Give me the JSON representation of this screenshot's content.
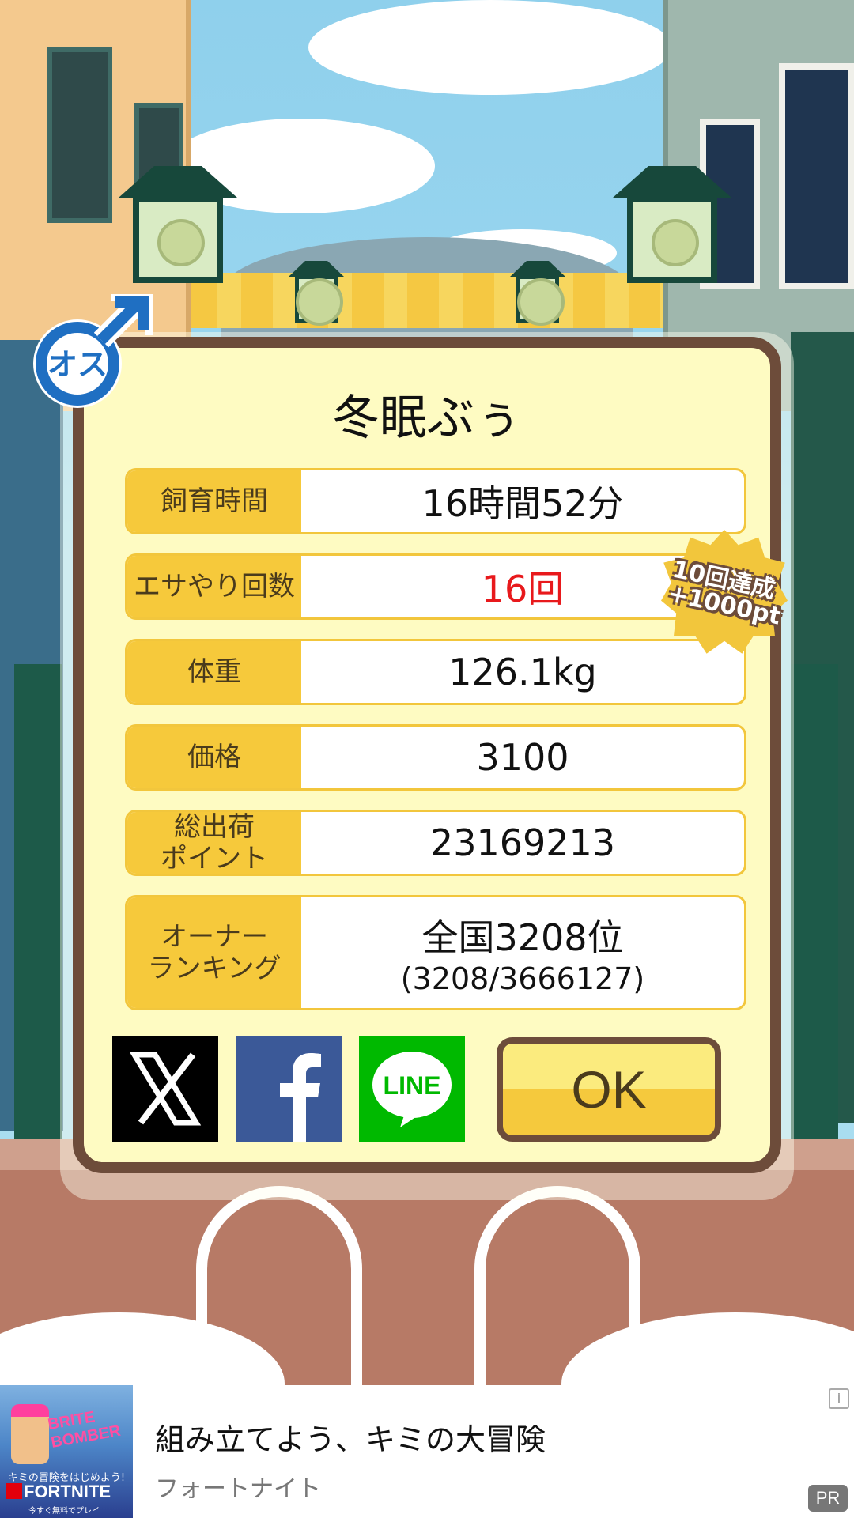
{
  "pet": {
    "name": "冬眠ぶぅ",
    "gender_label": "オス"
  },
  "stats": [
    {
      "label": "飼育時間",
      "value": "16時間52分",
      "sub": ""
    },
    {
      "label": "エサやり回数",
      "value": "16回",
      "sub": ""
    },
    {
      "label": "体重",
      "value": "126.1kg",
      "sub": ""
    },
    {
      "label": "価格",
      "value": "3100",
      "sub": ""
    },
    {
      "label": "総出荷\nポイント",
      "value": "23169213",
      "sub": ""
    },
    {
      "label": "オーナー\nランキング",
      "value": "全国3208位",
      "sub": "(3208/3666127)"
    }
  ],
  "achievement_badge": {
    "line1": "10回達成",
    "line2": "+1000pt"
  },
  "share": {
    "x_label": "X",
    "facebook_label": "f",
    "line_label": "LINE"
  },
  "ok_label": "OK",
  "ad": {
    "title": "組み立てよう、キミの大冒険",
    "advertiser": "フォートナイト",
    "pr_label": "PR",
    "info_label": "i",
    "image_text_1": "BRITE BOMBER",
    "image_text_2": "キミの冒険をはじめよう!",
    "image_text_3": "FORTNITE",
    "image_text_4": "今すぐ無料でプレイ"
  },
  "colors": {
    "dialog_bg": "#fefbc2",
    "dialog_border": "#6d4c3a",
    "label_bg": "#f6c93b",
    "feed_count_color": "#e8191c",
    "male_blue": "#1f6fc2"
  }
}
